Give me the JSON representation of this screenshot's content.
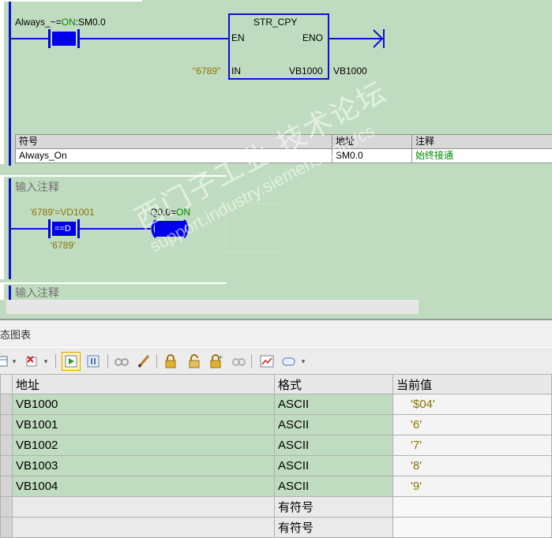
{
  "ladder": {
    "network1": {
      "contact_label": "Always_~=ON:SM0.0",
      "contact_label_value": "ON",
      "block_title": "STR_CPY",
      "pin_en": "EN",
      "pin_eno": "ENO",
      "pin_in": "IN",
      "pin_out": "VB1000",
      "in_value": "\"6789\"",
      "out_operand": "VB1000",
      "symbols": {
        "headers": [
          "符号",
          "地址",
          "注释"
        ],
        "rows": [
          [
            "Always_On",
            "SM0.0",
            "始终接通"
          ]
        ]
      }
    },
    "network2": {
      "comment": "输入注释",
      "compare_label": "'6789'=VD1001",
      "compare_op": "==D",
      "compare_operand2": "'6789'",
      "coil_label": "Q0.0=ON"
    },
    "network3": {
      "comment": "输入注释"
    }
  },
  "status_chart": {
    "title": "态图表",
    "toolbar_icons": [
      "table-icon",
      "delete-icon",
      "run-icon",
      "pause-icon",
      "glasses-icon",
      "pencil-icon",
      "lock-icon",
      "unlock-icon",
      "lock-plus-icon",
      "read-icon",
      "trend-icon",
      "tag-icon"
    ],
    "headers": [
      "地址",
      "格式",
      "当前值"
    ],
    "rows": [
      {
        "address": "VB1000",
        "format": "ASCII",
        "value": "'$04'"
      },
      {
        "address": "VB1001",
        "format": "ASCII",
        "value": "'6'"
      },
      {
        "address": "VB1002",
        "format": "ASCII",
        "value": "'7'"
      },
      {
        "address": "VB1003",
        "format": "ASCII",
        "value": "'8'"
      },
      {
        "address": "VB1004",
        "format": "ASCII",
        "value": "'9'"
      },
      {
        "address": "",
        "format": "有符号",
        "value": ""
      },
      {
        "address": "",
        "format": "有符号",
        "value": ""
      }
    ]
  },
  "watermark": {
    "line1": "西门子工业  技术论坛",
    "line2": "support.industry.siemens.com/cs"
  }
}
